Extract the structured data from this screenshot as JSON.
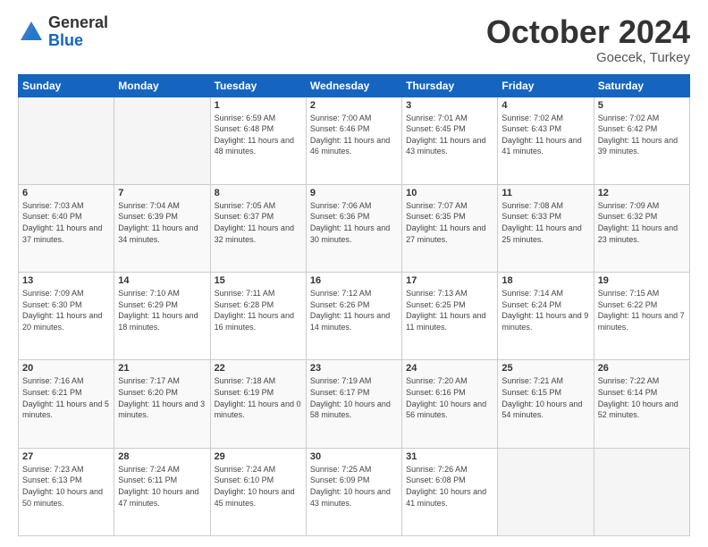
{
  "header": {
    "logo_general": "General",
    "logo_blue": "Blue",
    "month_title": "October 2024",
    "location": "Goecek, Turkey"
  },
  "weekdays": [
    "Sunday",
    "Monday",
    "Tuesday",
    "Wednesday",
    "Thursday",
    "Friday",
    "Saturday"
  ],
  "weeks": [
    [
      {
        "day": "",
        "sunrise": "",
        "sunset": "",
        "daylight": "",
        "empty": true
      },
      {
        "day": "",
        "sunrise": "",
        "sunset": "",
        "daylight": "",
        "empty": true
      },
      {
        "day": "1",
        "sunrise": "Sunrise: 6:59 AM",
        "sunset": "Sunset: 6:48 PM",
        "daylight": "Daylight: 11 hours and 48 minutes."
      },
      {
        "day": "2",
        "sunrise": "Sunrise: 7:00 AM",
        "sunset": "Sunset: 6:46 PM",
        "daylight": "Daylight: 11 hours and 46 minutes."
      },
      {
        "day": "3",
        "sunrise": "Sunrise: 7:01 AM",
        "sunset": "Sunset: 6:45 PM",
        "daylight": "Daylight: 11 hours and 43 minutes."
      },
      {
        "day": "4",
        "sunrise": "Sunrise: 7:02 AM",
        "sunset": "Sunset: 6:43 PM",
        "daylight": "Daylight: 11 hours and 41 minutes."
      },
      {
        "day": "5",
        "sunrise": "Sunrise: 7:02 AM",
        "sunset": "Sunset: 6:42 PM",
        "daylight": "Daylight: 11 hours and 39 minutes."
      }
    ],
    [
      {
        "day": "6",
        "sunrise": "Sunrise: 7:03 AM",
        "sunset": "Sunset: 6:40 PM",
        "daylight": "Daylight: 11 hours and 37 minutes."
      },
      {
        "day": "7",
        "sunrise": "Sunrise: 7:04 AM",
        "sunset": "Sunset: 6:39 PM",
        "daylight": "Daylight: 11 hours and 34 minutes."
      },
      {
        "day": "8",
        "sunrise": "Sunrise: 7:05 AM",
        "sunset": "Sunset: 6:37 PM",
        "daylight": "Daylight: 11 hours and 32 minutes."
      },
      {
        "day": "9",
        "sunrise": "Sunrise: 7:06 AM",
        "sunset": "Sunset: 6:36 PM",
        "daylight": "Daylight: 11 hours and 30 minutes."
      },
      {
        "day": "10",
        "sunrise": "Sunrise: 7:07 AM",
        "sunset": "Sunset: 6:35 PM",
        "daylight": "Daylight: 11 hours and 27 minutes."
      },
      {
        "day": "11",
        "sunrise": "Sunrise: 7:08 AM",
        "sunset": "Sunset: 6:33 PM",
        "daylight": "Daylight: 11 hours and 25 minutes."
      },
      {
        "day": "12",
        "sunrise": "Sunrise: 7:09 AM",
        "sunset": "Sunset: 6:32 PM",
        "daylight": "Daylight: 11 hours and 23 minutes."
      }
    ],
    [
      {
        "day": "13",
        "sunrise": "Sunrise: 7:09 AM",
        "sunset": "Sunset: 6:30 PM",
        "daylight": "Daylight: 11 hours and 20 minutes."
      },
      {
        "day": "14",
        "sunrise": "Sunrise: 7:10 AM",
        "sunset": "Sunset: 6:29 PM",
        "daylight": "Daylight: 11 hours and 18 minutes."
      },
      {
        "day": "15",
        "sunrise": "Sunrise: 7:11 AM",
        "sunset": "Sunset: 6:28 PM",
        "daylight": "Daylight: 11 hours and 16 minutes."
      },
      {
        "day": "16",
        "sunrise": "Sunrise: 7:12 AM",
        "sunset": "Sunset: 6:26 PM",
        "daylight": "Daylight: 11 hours and 14 minutes."
      },
      {
        "day": "17",
        "sunrise": "Sunrise: 7:13 AM",
        "sunset": "Sunset: 6:25 PM",
        "daylight": "Daylight: 11 hours and 11 minutes."
      },
      {
        "day": "18",
        "sunrise": "Sunrise: 7:14 AM",
        "sunset": "Sunset: 6:24 PM",
        "daylight": "Daylight: 11 hours and 9 minutes."
      },
      {
        "day": "19",
        "sunrise": "Sunrise: 7:15 AM",
        "sunset": "Sunset: 6:22 PM",
        "daylight": "Daylight: 11 hours and 7 minutes."
      }
    ],
    [
      {
        "day": "20",
        "sunrise": "Sunrise: 7:16 AM",
        "sunset": "Sunset: 6:21 PM",
        "daylight": "Daylight: 11 hours and 5 minutes."
      },
      {
        "day": "21",
        "sunrise": "Sunrise: 7:17 AM",
        "sunset": "Sunset: 6:20 PM",
        "daylight": "Daylight: 11 hours and 3 minutes."
      },
      {
        "day": "22",
        "sunrise": "Sunrise: 7:18 AM",
        "sunset": "Sunset: 6:19 PM",
        "daylight": "Daylight: 11 hours and 0 minutes."
      },
      {
        "day": "23",
        "sunrise": "Sunrise: 7:19 AM",
        "sunset": "Sunset: 6:17 PM",
        "daylight": "Daylight: 10 hours and 58 minutes."
      },
      {
        "day": "24",
        "sunrise": "Sunrise: 7:20 AM",
        "sunset": "Sunset: 6:16 PM",
        "daylight": "Daylight: 10 hours and 56 minutes."
      },
      {
        "day": "25",
        "sunrise": "Sunrise: 7:21 AM",
        "sunset": "Sunset: 6:15 PM",
        "daylight": "Daylight: 10 hours and 54 minutes."
      },
      {
        "day": "26",
        "sunrise": "Sunrise: 7:22 AM",
        "sunset": "Sunset: 6:14 PM",
        "daylight": "Daylight: 10 hours and 52 minutes."
      }
    ],
    [
      {
        "day": "27",
        "sunrise": "Sunrise: 7:23 AM",
        "sunset": "Sunset: 6:13 PM",
        "daylight": "Daylight: 10 hours and 50 minutes."
      },
      {
        "day": "28",
        "sunrise": "Sunrise: 7:24 AM",
        "sunset": "Sunset: 6:11 PM",
        "daylight": "Daylight: 10 hours and 47 minutes."
      },
      {
        "day": "29",
        "sunrise": "Sunrise: 7:24 AM",
        "sunset": "Sunset: 6:10 PM",
        "daylight": "Daylight: 10 hours and 45 minutes."
      },
      {
        "day": "30",
        "sunrise": "Sunrise: 7:25 AM",
        "sunset": "Sunset: 6:09 PM",
        "daylight": "Daylight: 10 hours and 43 minutes."
      },
      {
        "day": "31",
        "sunrise": "Sunrise: 7:26 AM",
        "sunset": "Sunset: 6:08 PM",
        "daylight": "Daylight: 10 hours and 41 minutes."
      },
      {
        "day": "",
        "sunrise": "",
        "sunset": "",
        "daylight": "",
        "empty": true
      },
      {
        "day": "",
        "sunrise": "",
        "sunset": "",
        "daylight": "",
        "empty": true
      }
    ]
  ]
}
